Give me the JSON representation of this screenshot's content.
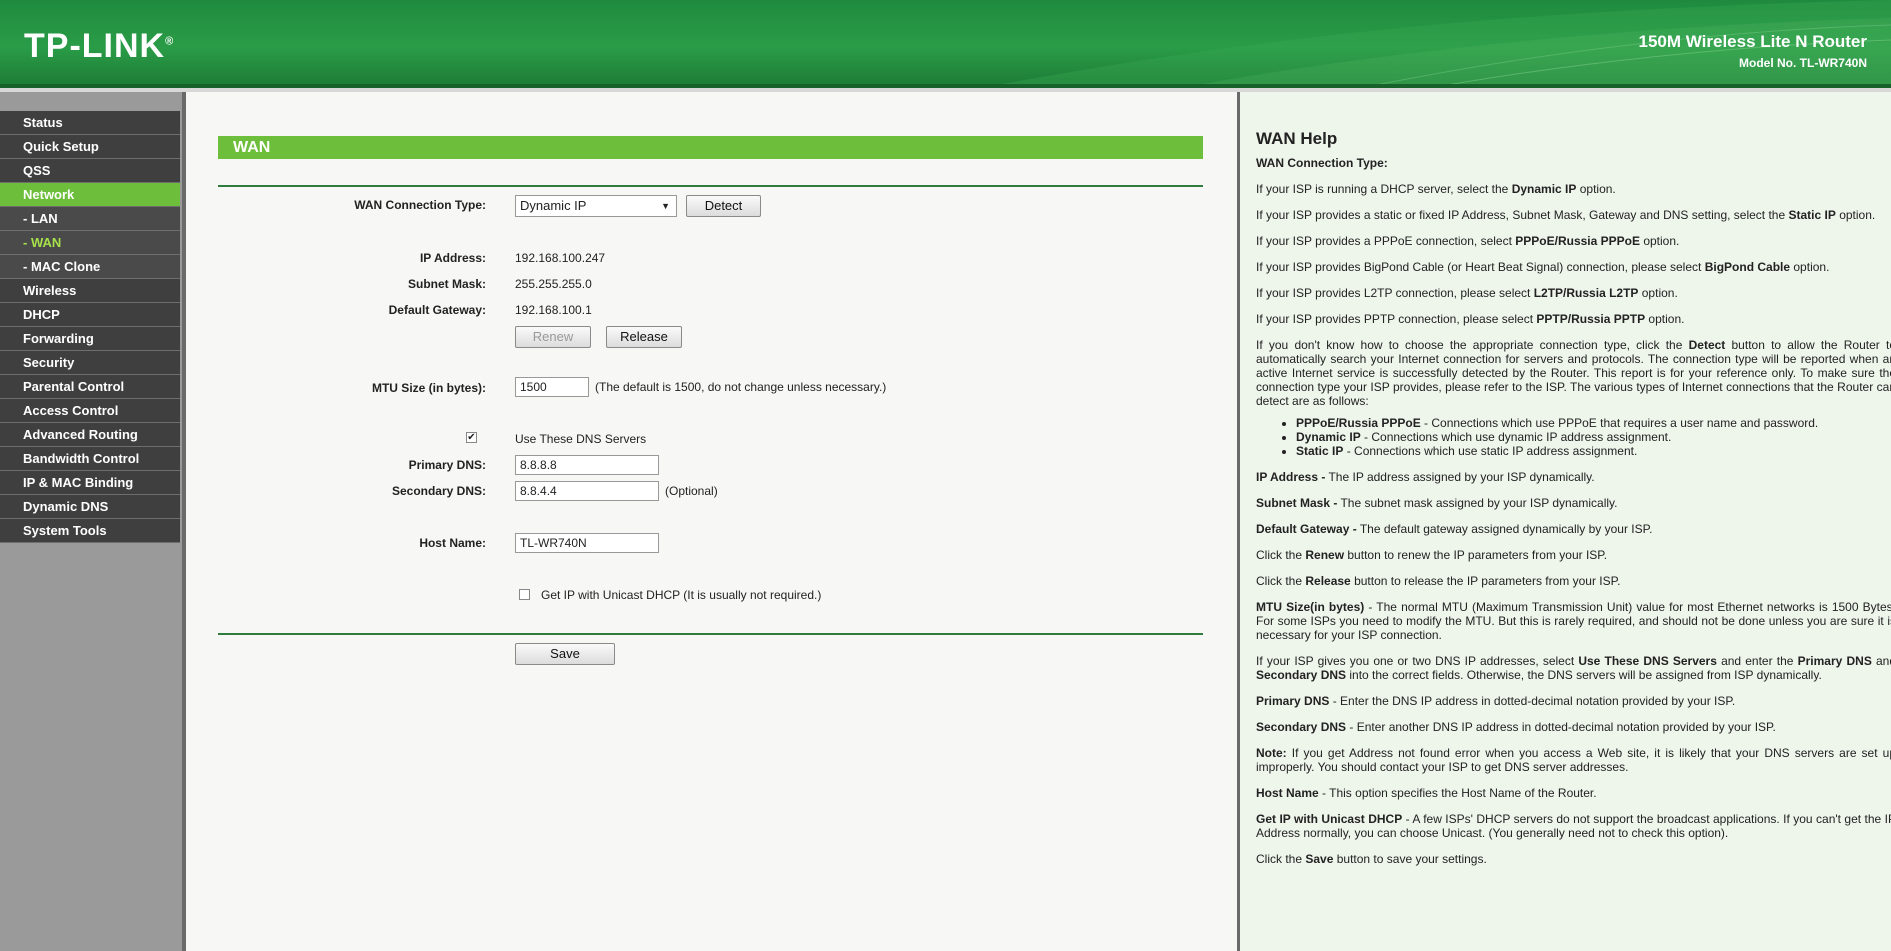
{
  "header": {
    "logo": "TP-LINK",
    "logo_mark": "®",
    "product_name": "150M Wireless Lite N Router",
    "model": "Model No. TL-WR740N"
  },
  "sidebar": {
    "items": [
      {
        "label": "Status"
      },
      {
        "label": "Quick Setup"
      },
      {
        "label": "QSS"
      },
      {
        "label": "Network"
      },
      {
        "label": "- LAN"
      },
      {
        "label": "- WAN"
      },
      {
        "label": "- MAC Clone"
      },
      {
        "label": "Wireless"
      },
      {
        "label": "DHCP"
      },
      {
        "label": "Forwarding"
      },
      {
        "label": "Security"
      },
      {
        "label": "Parental Control"
      },
      {
        "label": "Access Control"
      },
      {
        "label": "Advanced Routing"
      },
      {
        "label": "Bandwidth Control"
      },
      {
        "label": "IP & MAC Binding"
      },
      {
        "label": "Dynamic DNS"
      },
      {
        "label": "System Tools"
      }
    ]
  },
  "wan": {
    "title": "WAN",
    "connection_type_label": "WAN Connection Type:",
    "connection_type_value": "Dynamic IP",
    "detect_label": "Detect",
    "ip_label": "IP Address:",
    "ip_value": "192.168.100.247",
    "subnet_label": "Subnet Mask:",
    "subnet_value": "255.255.255.0",
    "gateway_label": "Default Gateway:",
    "gateway_value": "192.168.100.1",
    "renew_label": "Renew",
    "release_label": "Release",
    "mtu_label": "MTU Size (in bytes):",
    "mtu_value": "1500",
    "mtu_hint": "(The default is 1500, do not change unless necessary.)",
    "dns_check_label": "Use These DNS Servers",
    "dns_checked": true,
    "primary_dns_label": "Primary DNS:",
    "primary_dns_value": "8.8.8.8",
    "secondary_dns_label": "Secondary DNS:",
    "secondary_dns_value": "8.8.4.4",
    "optional_hint": "(Optional)",
    "host_label": "Host Name:",
    "host_value": "TL-WR740N",
    "unicast_label": "Get IP with Unicast DHCP (It is usually not required.)",
    "unicast_checked": false,
    "save_label": "Save"
  },
  "help": {
    "title": "WAN Help",
    "conn_type_heading": "WAN Connection Type:",
    "p_dhcp_a": "If your ISP is running a DHCP server, select the ",
    "p_dhcp_b": "Dynamic IP",
    "p_dhcp_c": " option.",
    "p_static_a": "If your ISP provides a static or fixed IP Address, Subnet Mask, Gateway and DNS setting, select the ",
    "p_static_b": "Static IP",
    "p_static_c": " option.",
    "p_pppoe_a": "If your ISP provides a PPPoE connection, select ",
    "p_pppoe_b": "PPPoE/Russia PPPoE",
    "p_pppoe_c": " option.",
    "p_bigpond_a": "If your ISP provides BigPond Cable (or Heart Beat Signal) connection, please select ",
    "p_bigpond_b": "BigPond Cable",
    "p_bigpond_c": " option.",
    "p_l2tp_a": "If your ISP provides L2TP connection, please select ",
    "p_l2tp_b": "L2TP/Russia L2TP",
    "p_l2tp_c": " option.",
    "p_pptp_a": "If your ISP provides PPTP connection, please select ",
    "p_pptp_b": "PPTP/Russia PPTP",
    "p_pptp_c": " option.",
    "p_detect_a": "If you don't know how to choose the appropriate connection type, click the ",
    "p_detect_b": "Detect",
    "p_detect_c": " button to allow the Router to automatically search your Internet connection for servers and protocols. The connection type will be reported when an active Internet service is successfully detected by the Router. This report is for your reference only. To make sure the connection type your ISP provides, please refer to the ISP. The various types of Internet connections that the Router can detect are as follows:",
    "li1_b": "PPPoE/Russia PPPoE",
    "li1_c": " - Connections which use PPPoE that requires a user name and password.",
    "li2_b": "Dynamic IP",
    "li2_c": " - Connections which use dynamic IP address assignment.",
    "li3_b": "Static IP",
    "li3_c": " - Connections which use static IP address assignment.",
    "ip_b": "IP Address -",
    "ip_c": " The IP address assigned by your ISP dynamically.",
    "mask_b": "Subnet Mask -",
    "mask_c": " The subnet mask assigned by your ISP dynamically.",
    "gw_b": "Default Gateway -",
    "gw_c": " The default gateway assigned dynamically by your ISP.",
    "renew_a": "Click the ",
    "renew_b": "Renew",
    "renew_c": " button to renew the IP parameters from your ISP.",
    "release_a": "Click the ",
    "release_b": "Release",
    "release_c": " button to release the IP parameters from your ISP.",
    "mtu_b": "MTU Size(in bytes)",
    "mtu_c": " - The normal MTU (Maximum Transmission Unit) value for most Ethernet networks is 1500 Bytes. For some ISPs you need to modify the MTU. But this is rarely required, and should not be done unless you are sure it is necessary for your ISP connection.",
    "dns_a": "If your ISP gives you one or two DNS IP addresses, select ",
    "dns_b": "Use These DNS Servers",
    "dns_c": " and enter the ",
    "dns_d": "Primary DNS",
    "dns_e": " and ",
    "dns_f": "Secondary DNS",
    "dns_g": " into the correct fields. Otherwise, the DNS servers will be assigned from ISP dynamically.",
    "pdns_b": "Primary DNS",
    "pdns_c": " - Enter the DNS IP address in dotted-decimal notation provided by your ISP.",
    "sdns_b": "Secondary DNS",
    "sdns_c": " - Enter another DNS IP address in dotted-decimal notation provided by your ISP.",
    "note_b": "Note:",
    "note_c": " If you get Address not found error when you access a Web site, it is likely that your DNS servers are set up improperly. You should contact your ISP to get DNS server addresses.",
    "host_b": "Host Name",
    "host_c": " - This option specifies the Host Name of the Router.",
    "uni_b": "Get IP with Unicast DHCP",
    "uni_c": " - A few ISPs' DHCP servers do not support the broadcast applications. If you can't get the IP Address normally, you can choose Unicast. (You generally need not to check this option).",
    "save_a": "Click the ",
    "save_b": "Save",
    "save_c": " button to save your settings."
  }
}
